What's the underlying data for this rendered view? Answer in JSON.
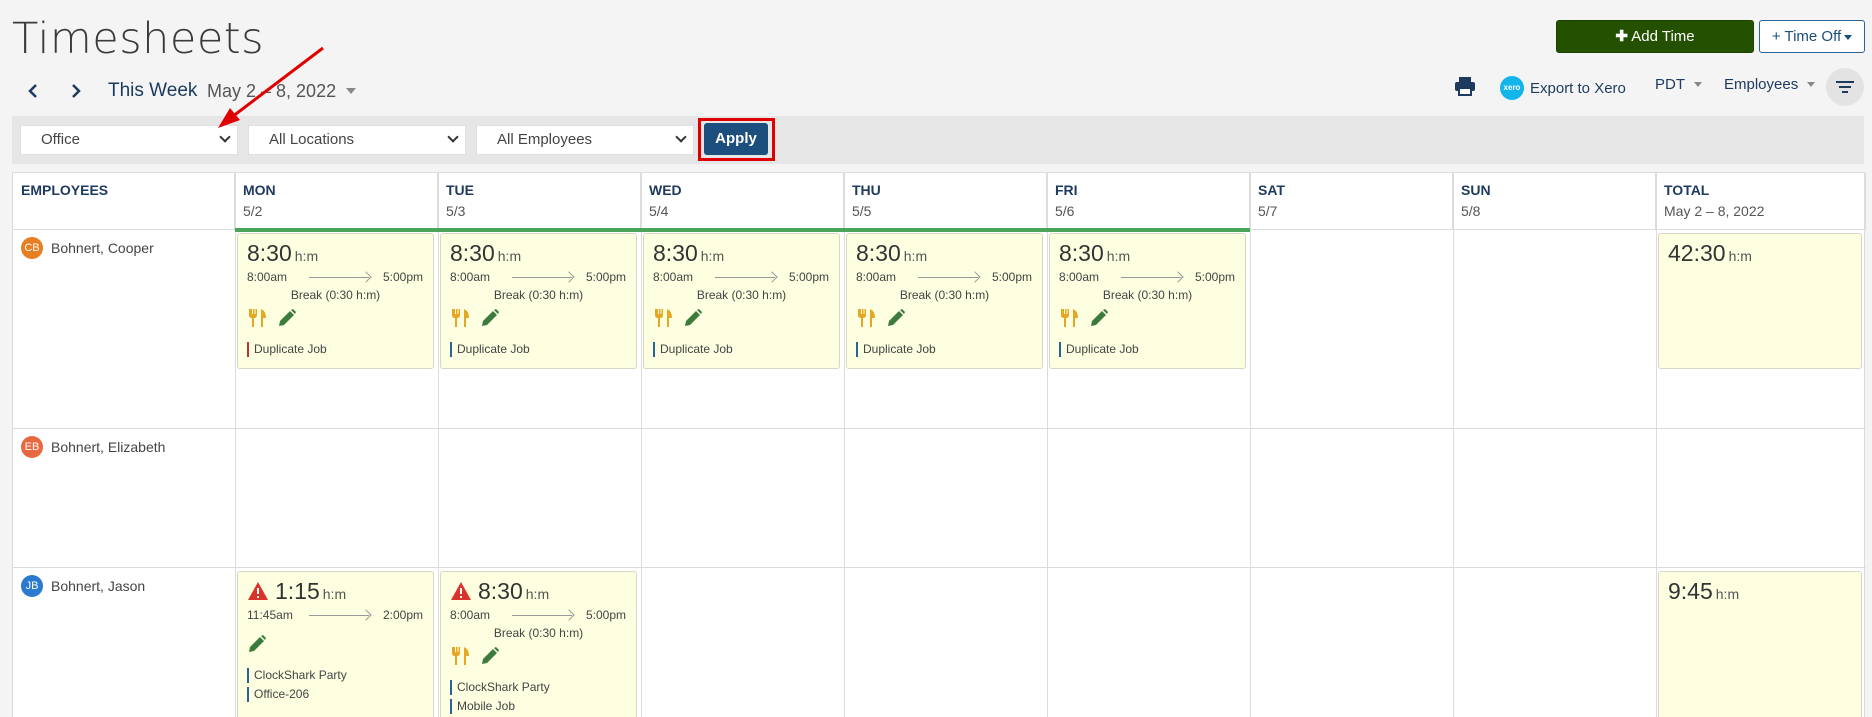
{
  "page": {
    "title": "Timesheets"
  },
  "nav": {
    "prev": "‹",
    "next": "›",
    "week_label": "This Week",
    "date_range": "May 2 – 8, 2022"
  },
  "actions": {
    "add_time": "Add Time",
    "time_off": "+ Time Off"
  },
  "toolbar": {
    "export": "Export to Xero",
    "timezone": "PDT",
    "employees": "Employees",
    "xero_badge": "xero"
  },
  "filters": {
    "group": "Office",
    "locations": "All Locations",
    "employees": "All Employees",
    "apply": "Apply"
  },
  "columns": [
    {
      "name": "EMPLOYEES",
      "date": ""
    },
    {
      "name": "MON",
      "date": "5/2"
    },
    {
      "name": "TUE",
      "date": "5/3"
    },
    {
      "name": "WED",
      "date": "5/4"
    },
    {
      "name": "THU",
      "date": "5/5"
    },
    {
      "name": "FRI",
      "date": "5/6"
    },
    {
      "name": "SAT",
      "date": "5/7"
    },
    {
      "name": "SUN",
      "date": "5/8"
    },
    {
      "name": "TOTAL",
      "date": "May 2 – 8, 2022"
    }
  ],
  "unit": "h:m",
  "employees": [
    {
      "name": "Bohnert, Cooper",
      "initials": "CB",
      "color": "#e67e22",
      "total": "42:30",
      "entries": [
        {
          "day": 1,
          "hours": "8:30",
          "start": "8:00am",
          "end": "5:00pm",
          "break": "Break (0:30 h:m)",
          "jobs": [
            "Duplicate Job"
          ],
          "warn": false,
          "meal": true
        },
        {
          "day": 2,
          "hours": "8:30",
          "start": "8:00am",
          "end": "5:00pm",
          "break": "Break (0:30 h:m)",
          "jobs": [
            "Duplicate Job"
          ],
          "warn": false,
          "meal": true
        },
        {
          "day": 3,
          "hours": "8:30",
          "start": "8:00am",
          "end": "5:00pm",
          "break": "Break (0:30 h:m)",
          "jobs": [
            "Duplicate Job"
          ],
          "warn": false,
          "meal": true
        },
        {
          "day": 4,
          "hours": "8:30",
          "start": "8:00am",
          "end": "5:00pm",
          "break": "Break (0:30 h:m)",
          "jobs": [
            "Duplicate Job"
          ],
          "warn": false,
          "meal": true
        },
        {
          "day": 5,
          "hours": "8:30",
          "start": "8:00am",
          "end": "5:00pm",
          "break": "Break (0:30 h:m)",
          "jobs": [
            "Duplicate Job"
          ],
          "warn": false,
          "meal": true
        }
      ]
    },
    {
      "name": "Bohnert, Elizabeth",
      "initials": "EB",
      "color": "#e8693f",
      "total": "",
      "entries": []
    },
    {
      "name": "Bohnert, Jason",
      "initials": "JB",
      "color": "#2a7bd0",
      "total": "9:45",
      "entries": [
        {
          "day": 1,
          "hours": "1:15",
          "start": "11:45am",
          "end": "2:00pm",
          "break": "",
          "jobs": [
            "ClockShark Party",
            "Office-206"
          ],
          "warn": true,
          "meal": false
        },
        {
          "day": 2,
          "hours": "8:30",
          "start": "8:00am",
          "end": "5:00pm",
          "break": "Break (0:30 h:m)",
          "jobs": [
            "ClockShark Party",
            "Mobile Job"
          ],
          "warn": true,
          "meal": true
        }
      ]
    }
  ],
  "colors": {
    "accent": "#1d4f7e",
    "add_time": "#245100",
    "card_bg": "#fefee0",
    "warn": "#d9342b",
    "meal": "#e5a823",
    "edit": "#3d7a3d"
  }
}
